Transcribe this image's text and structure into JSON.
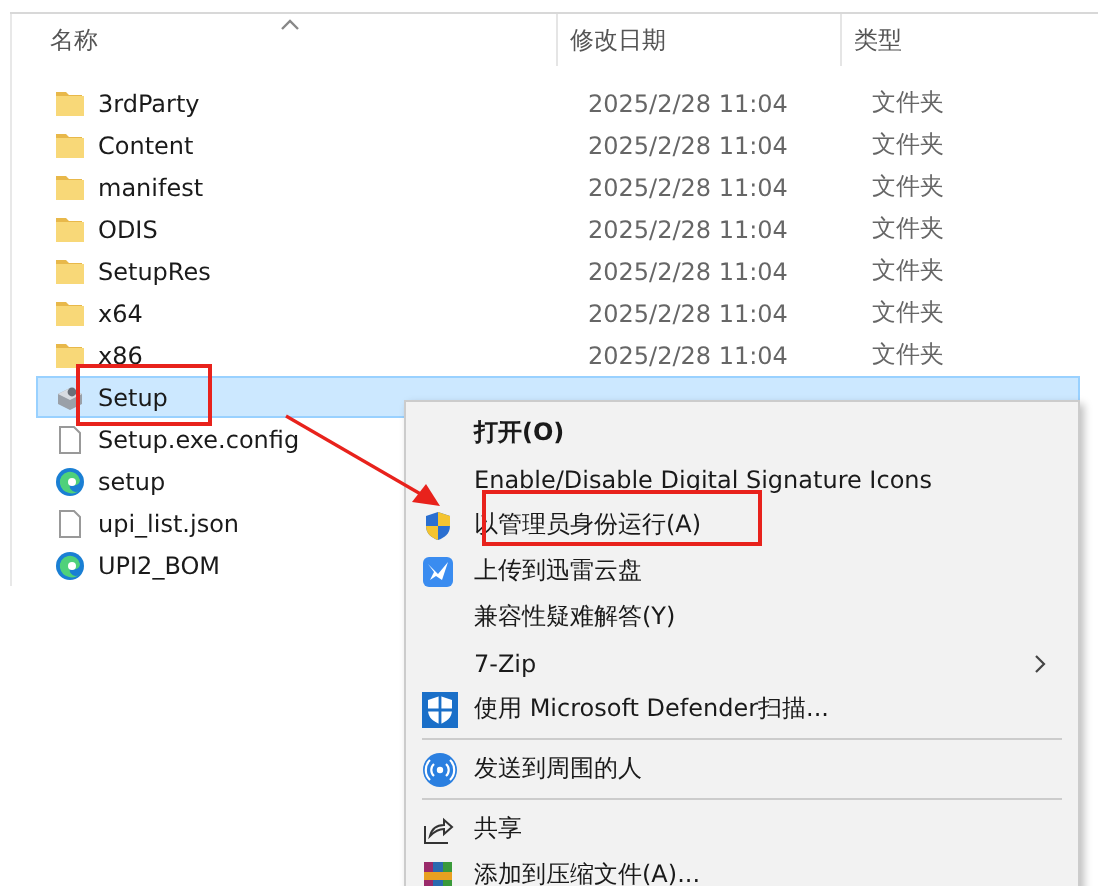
{
  "columns": [
    {
      "label": "名称",
      "sorted": true
    },
    {
      "label": "修改日期",
      "sorted": false
    },
    {
      "label": "类型",
      "sorted": false
    }
  ],
  "files": [
    {
      "name": "3rdParty",
      "kind": "folder",
      "date": "2025/2/28 11:04",
      "type": "文件夹",
      "selected": false
    },
    {
      "name": "Content",
      "kind": "folder",
      "date": "2025/2/28 11:04",
      "type": "文件夹",
      "selected": false
    },
    {
      "name": "manifest",
      "kind": "folder",
      "date": "2025/2/28 11:04",
      "type": "文件夹",
      "selected": false
    },
    {
      "name": "ODIS",
      "kind": "folder",
      "date": "2025/2/28 11:04",
      "type": "文件夹",
      "selected": false
    },
    {
      "name": "SetupRes",
      "kind": "folder",
      "date": "2025/2/28 11:04",
      "type": "文件夹",
      "selected": false
    },
    {
      "name": "x64",
      "kind": "folder",
      "date": "2025/2/28 11:04",
      "type": "文件夹",
      "selected": false
    },
    {
      "name": "x86",
      "kind": "folder",
      "date": "2025/2/28 11:04",
      "type": "文件夹",
      "selected": false
    },
    {
      "name": "Setup",
      "kind": "app",
      "selected": true
    },
    {
      "name": "Setup.exe.config",
      "kind": "file",
      "selected": false
    },
    {
      "name": "setup",
      "kind": "edge",
      "selected": false
    },
    {
      "name": "upi_list.json",
      "kind": "file",
      "selected": false
    },
    {
      "name": "UPI2_BOM",
      "kind": "edge",
      "selected": false
    }
  ],
  "context_menu": [
    {
      "kind": "plain",
      "label": "打开(O)",
      "bold": true,
      "submenu": false
    },
    {
      "kind": "plain",
      "label": "Enable/Disable Digital Signature Icons",
      "bold": false,
      "submenu": false
    },
    {
      "kind": "shield",
      "label": "以管理员身份运行(A)",
      "bold": false,
      "submenu": false
    },
    {
      "kind": "upload",
      "label": "上传到迅雷云盘",
      "bold": false,
      "submenu": false
    },
    {
      "kind": "plain",
      "label": "兼容性疑难解答(Y)",
      "bold": false,
      "submenu": false
    },
    {
      "kind": "plain",
      "label": "7-Zip",
      "bold": false,
      "submenu": true
    },
    {
      "kind": "scan",
      "label": "使用 Microsoft Defender扫描...",
      "bold": false,
      "submenu": false
    },
    {
      "kind": "separator"
    },
    {
      "kind": "nearby",
      "label": "发送到周围的人",
      "bold": false,
      "submenu": false
    },
    {
      "kind": "separator"
    },
    {
      "kind": "share",
      "label": "共享",
      "bold": false,
      "submenu": false
    },
    {
      "kind": "archive",
      "label": "添加到压缩文件(A)...",
      "bold": false,
      "submenu": false
    }
  ]
}
